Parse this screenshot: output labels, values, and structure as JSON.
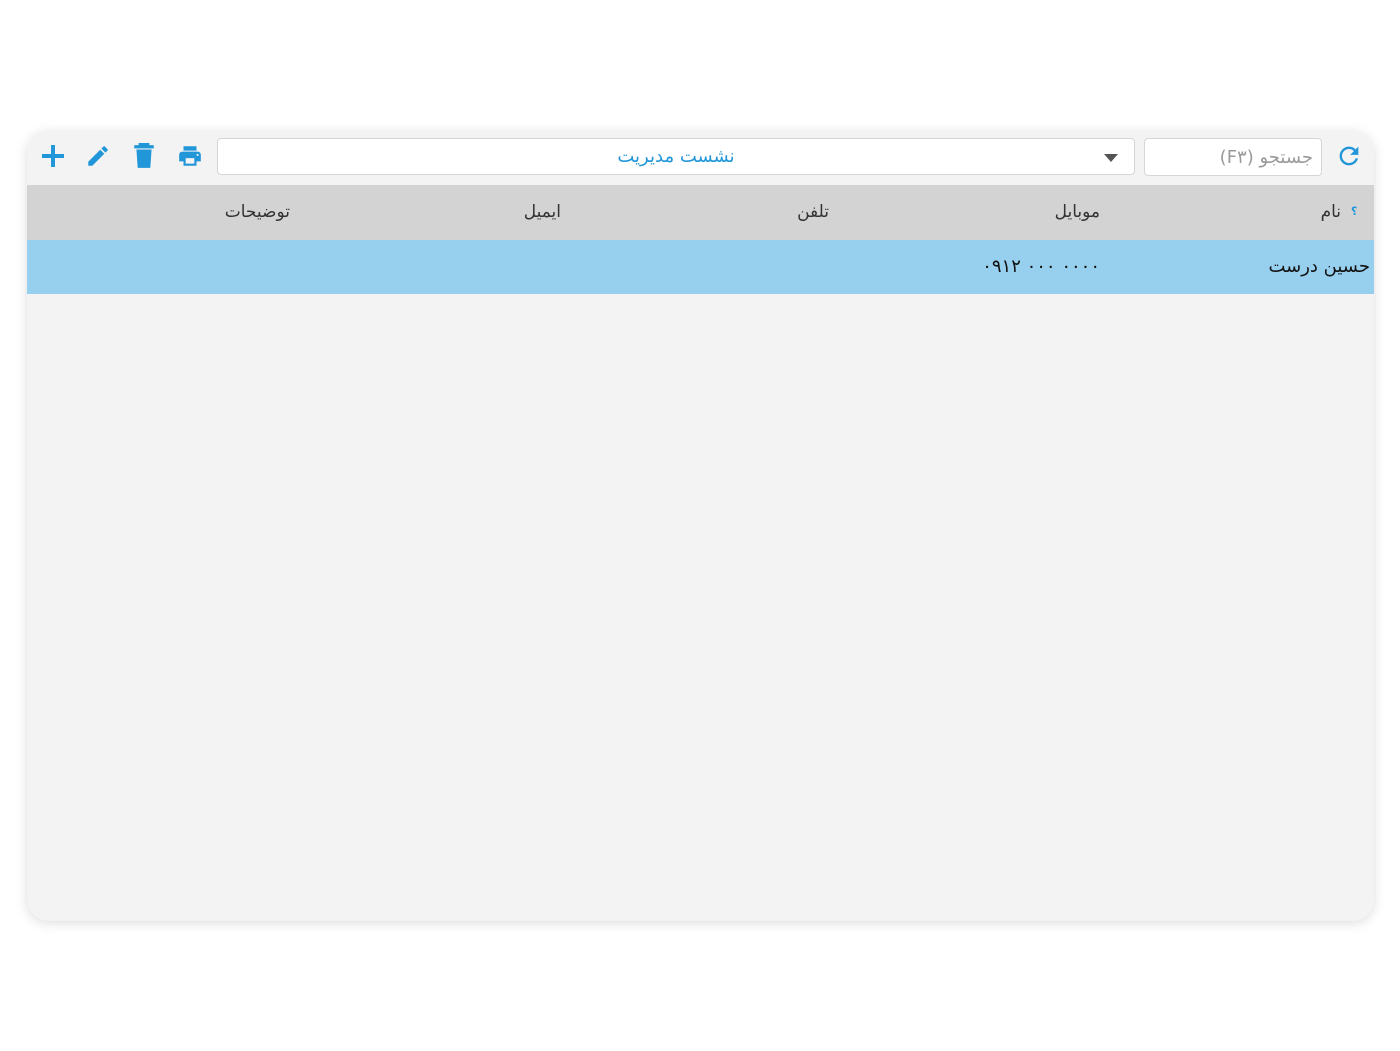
{
  "toolbar": {
    "add_icon": "plus-icon",
    "edit_icon": "pencil-icon",
    "delete_icon": "trash-icon",
    "print_icon": "printer-icon",
    "refresh_icon": "refresh-icon",
    "dropdown_value": "نشست مدیریت",
    "search_placeholder": "جستجو (F۳)",
    "accent_color": "#2196d9"
  },
  "table": {
    "help_mark": "؟",
    "columns": {
      "name": "نام",
      "mobile": "موبایل",
      "phone": "تلفن",
      "email": "ایمیل",
      "notes": "توضیحات"
    },
    "rows": [
      {
        "name": "حسین درست",
        "mobile": "۰۹۱۲ ۰۰۰ ۰۰۰۰",
        "phone": "",
        "email": "",
        "notes": ""
      }
    ],
    "header_bg": "#d3d3d3",
    "selected_row_bg": "#97cfee"
  }
}
